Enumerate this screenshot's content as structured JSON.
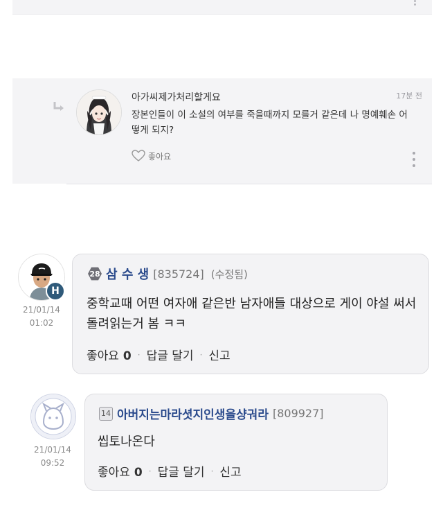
{
  "top_card": {
    "menu_icon": "vertical-dots-icon"
  },
  "reply": {
    "author": "아가씨제가처리할게요",
    "time": "17분 전",
    "text": "장본인들이 이 소설의 여부를 죽을때까지 모를거 같은데 나 명예훼손 어떻게 되지?",
    "like_label": "좋아요",
    "icons": {
      "arrow": "reply-arrow-icon",
      "heart": "heart-icon",
      "menu": "vertical-dots-icon"
    }
  },
  "comments": [
    {
      "level": "28",
      "nickname": "삼 수 생",
      "user_id": "[835724]",
      "edited": "(수정됨)",
      "date": "21/01/14",
      "time": "01:02",
      "badge": "H",
      "text": "중학교때 어떤 여자애 같은반 남자애들 대상으로 게이 야설 써서 돌려읽는거 봄 ㅋㅋ",
      "like_label": "좋아요",
      "like_count": "0",
      "reply_label": "답글 달기",
      "report_label": "신고"
    },
    {
      "level": "14",
      "nickname": "아버지는마라셧지인생을샹궈라",
      "user_id": "[809927]",
      "date": "21/01/14",
      "time": "09:52",
      "text": "씹토나온다",
      "like_label": "좋아요",
      "like_count": "0",
      "reply_label": "답글 달기",
      "report_label": "신고"
    }
  ],
  "separator": "·"
}
